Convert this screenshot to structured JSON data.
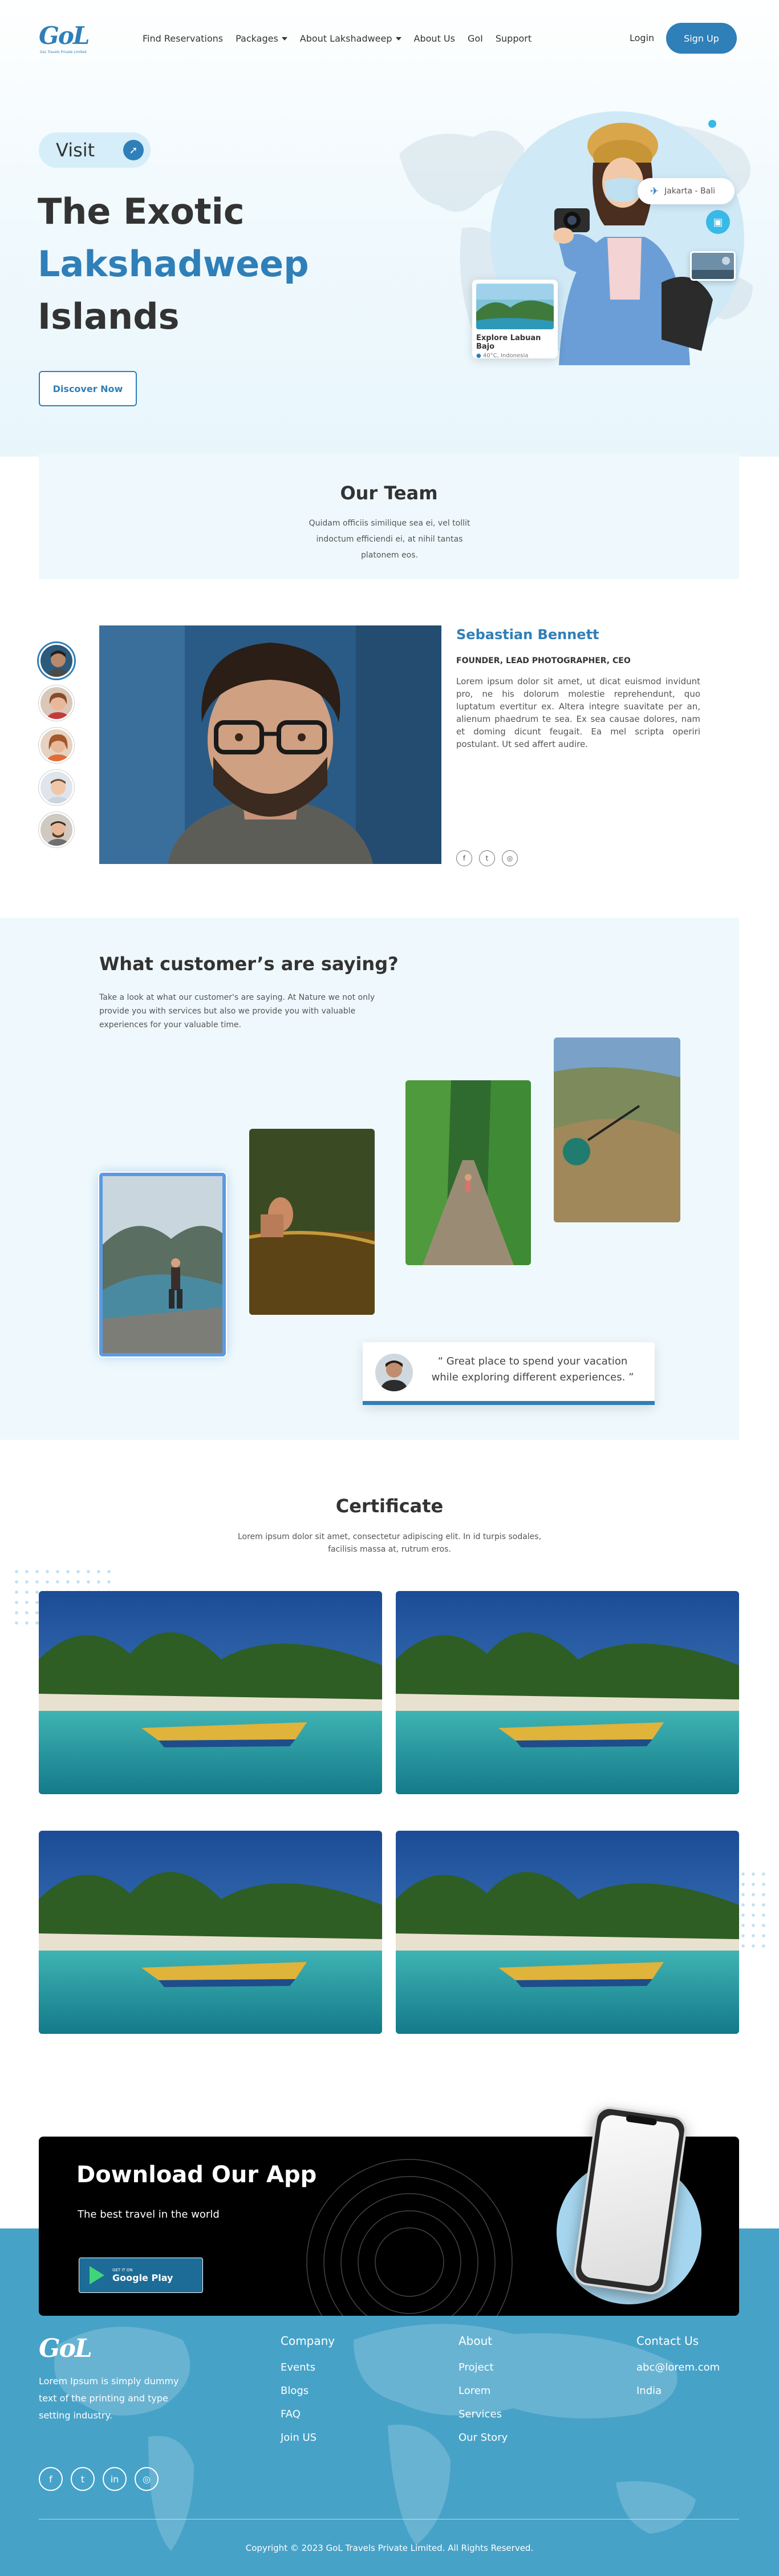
{
  "nav": {
    "logo": "GoL",
    "logo_tagline": "GoL Travels Private Limited",
    "links": [
      "Find Reservations",
      "Packages",
      "About Lakshadweep",
      "About Us",
      "GoI",
      "Support"
    ],
    "login": "Login",
    "signup": "Sign Up"
  },
  "hero": {
    "visit": "Visit",
    "title_line1": "The Exotic",
    "title_line2": "Lakshadweep",
    "title_line3": "Islands",
    "cta": "Discover Now",
    "location_chip": "Jakarta - Bali",
    "explore_title": "Explore Labuan Bajo",
    "explore_meta": "40°C, Indonesia"
  },
  "team": {
    "title": "Our Team",
    "subtitle": "Quidam officiis similique sea ei, vel tollit indoctum efficiendi ei, at nihil tantas platonem eos.",
    "member": {
      "name": "Sebastian Bennett",
      "role": "FOUNDER, LEAD PHOTOGRAPHER, CEO",
      "bio": "Lorem ipsum dolor sit amet, ut dicat euismod invidunt pro, ne his dolorum molestie reprehendunt, quo luptatum evertitur ex. Altera integre suavitate per an, alienum phaedrum te sea. Ex sea causae dolores, nam et doming dicunt feugait. Ea mel scripta operiri postulant. Ut sed affert audire."
    }
  },
  "testimonials": {
    "title": "What customer’s are saying?",
    "subtitle": "Take a look at what our customer's are saying. At Nature we not only provide you with services but also we provide you with valuable experiences for your valuable time.",
    "quote": "“ Great place to spend your vacation while exploring different experiences. ”"
  },
  "certificate": {
    "title": "Certificate",
    "subtitle": "Lorem ipsum dolor sit amet, consectetur adipiscing elit. In id turpis sodales, facilisis massa at, rutrum eros."
  },
  "app": {
    "title": "Download Our App",
    "subtitle": "The best travel in the world",
    "store_small": "GET IT ON",
    "store_name": "Google Play"
  },
  "footer": {
    "logo": "GoL",
    "about": "Lorem Ipsum is simply dummy text of the printing and type setting industry.",
    "company": {
      "title": "Company",
      "links": [
        "Events",
        "Blogs",
        "FAQ",
        "Join US"
      ]
    },
    "about_col": {
      "title": "About",
      "links": [
        "Project",
        "Lorem",
        "Services",
        "Our Story"
      ]
    },
    "contact": {
      "title": "Contact Us",
      "email": "abc@lorem.com",
      "country": "India"
    },
    "copyright": "Copyright © 2023 GoL Travels Private Limited. All Rights Reserved."
  },
  "colors": {
    "brand": "#2f7fb8",
    "footer": "#47a2c8",
    "light_bg": "#eff9fd"
  }
}
